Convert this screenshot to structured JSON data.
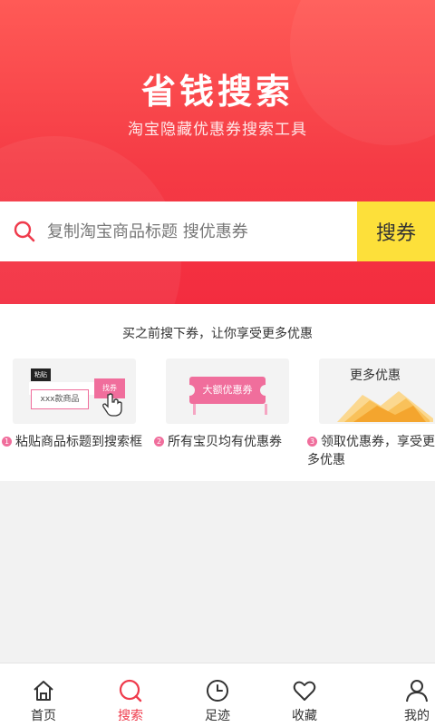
{
  "hero": {
    "title": "省钱搜索",
    "subtitle": "淘宝隐藏优惠券搜索工具"
  },
  "search": {
    "placeholder": "复制淘宝商品标题 搜优惠券",
    "button_label": "搜券"
  },
  "steps": {
    "heading": "买之前搜下券，让你享受更多优惠",
    "items": [
      {
        "num": "1",
        "text": "粘贴商品标题到搜索框",
        "illus_paste": "粘贴",
        "illus_product": "xxx款商品",
        "illus_button": "找券"
      },
      {
        "num": "2",
        "text": "所有宝贝均有优惠券",
        "illus_coupon": "大额优惠券"
      },
      {
        "num": "3",
        "text": "领取优惠券，享受更多优惠",
        "illus_title": "更多优惠"
      }
    ]
  },
  "tabbar": {
    "items": [
      {
        "label": "首页",
        "icon": "home-icon",
        "active": false
      },
      {
        "label": "搜索",
        "icon": "search-icon",
        "active": true
      },
      {
        "label": "足迹",
        "icon": "clock-icon",
        "active": false
      },
      {
        "label": "收藏",
        "icon": "heart-icon",
        "active": false
      },
      {
        "label": "我的",
        "icon": "user-icon",
        "active": false
      }
    ]
  },
  "colors": {
    "hero_red": "#f53b45",
    "search_button_yellow": "#fde03a",
    "active_tab": "#ef3b4c",
    "step_pink": "#f06e9c"
  }
}
